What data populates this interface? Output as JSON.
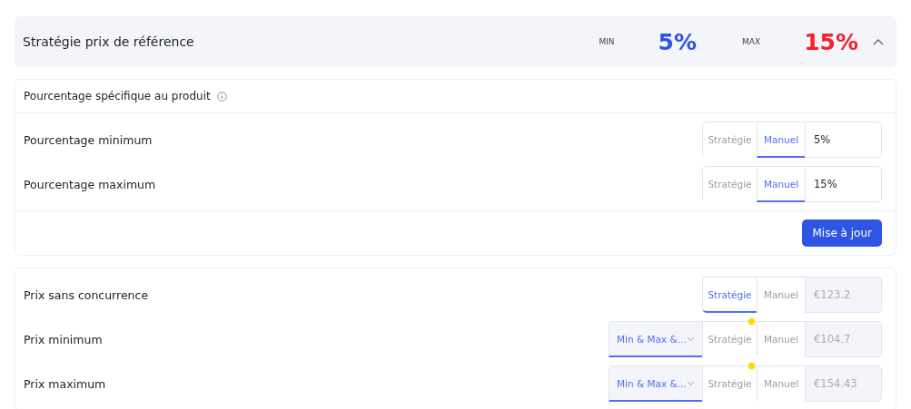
{
  "header": {
    "title": "Stratégie prix de référence",
    "min_label": "MIN",
    "min_value": "5%",
    "max_label": "MAX",
    "max_value": "15%",
    "expanded": true
  },
  "percent_card": {
    "title": "Pourcentage spécifique au produit",
    "rows": [
      {
        "label": "Pourcentage minimum",
        "modes": [
          {
            "label": "Stratégie",
            "selected": false,
            "indicator": false
          },
          {
            "label": "Manuel",
            "selected": true,
            "indicator": false
          }
        ],
        "value": "5%",
        "disabled": false
      },
      {
        "label": "Pourcentage maximum",
        "modes": [
          {
            "label": "Stratégie",
            "selected": false,
            "indicator": false
          },
          {
            "label": "Manuel",
            "selected": true,
            "indicator": false
          }
        ],
        "value": "15%",
        "disabled": false
      }
    ],
    "button": "Mise à jour"
  },
  "price_card": {
    "rows": [
      {
        "label": "Prix sans concurrence",
        "modes": [
          {
            "label": "Stratégie",
            "selected": true,
            "indicator": false
          },
          {
            "label": "Manuel",
            "selected": false,
            "indicator": false
          }
        ],
        "value": "€123.2",
        "disabled": true
      },
      {
        "label": "Prix minimum",
        "dropdown": "Min & Max &...",
        "modes": [
          {
            "label": "Stratégie",
            "selected": false,
            "indicator": true
          },
          {
            "label": "Manuel",
            "selected": false,
            "indicator": false
          }
        ],
        "value": "€104.7",
        "disabled": true
      },
      {
        "label": "Prix maximum",
        "dropdown": "Min & Max &...",
        "modes": [
          {
            "label": "Stratégie",
            "selected": false,
            "indicator": true
          },
          {
            "label": "Manuel",
            "selected": false,
            "indicator": false
          }
        ],
        "value": "€154.43",
        "disabled": true
      }
    ]
  }
}
